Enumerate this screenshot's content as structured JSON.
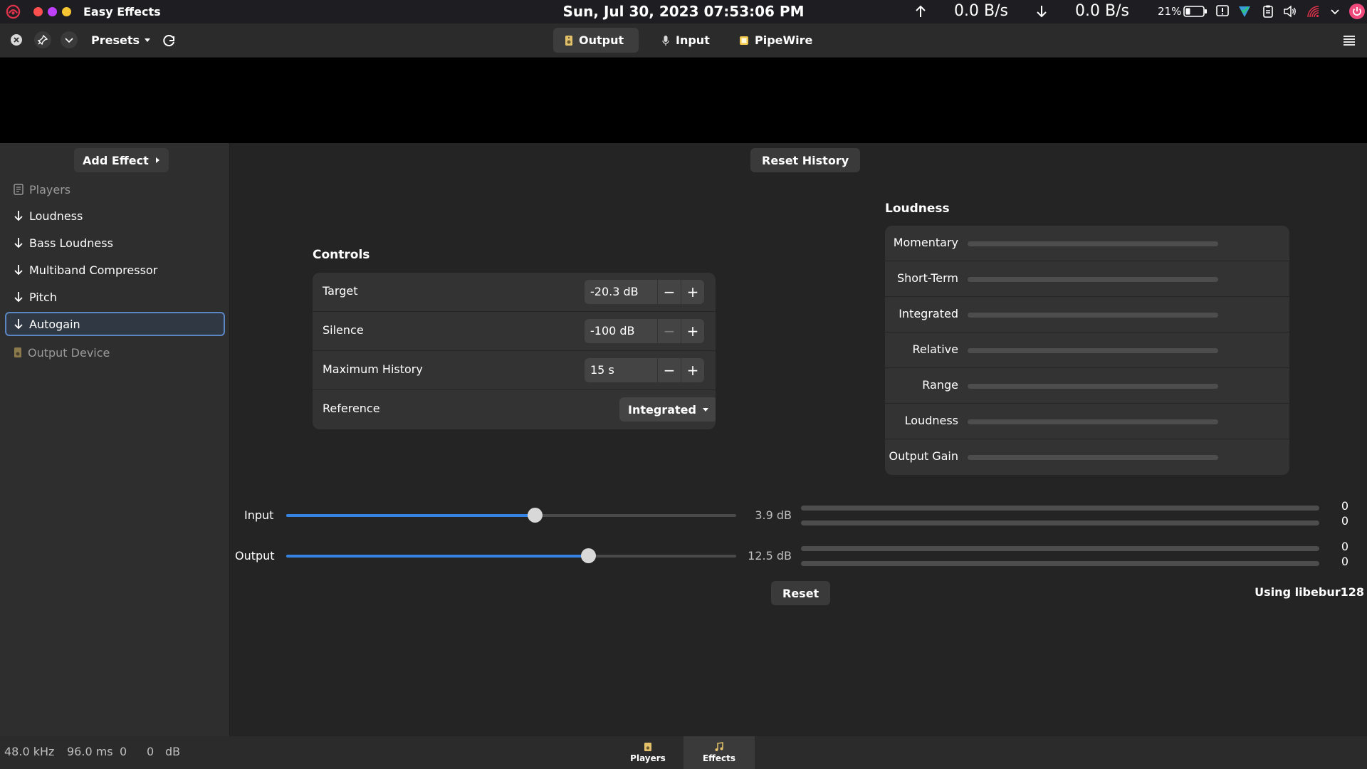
{
  "topbar": {
    "app_name": "Easy Effects",
    "datetime": "Sun, Jul 30, 2023  07:53:06 PM",
    "upload_rate": "0.0 B/s",
    "download_rate": "0.0 B/s",
    "battery_percent": "21%",
    "traffic_light_colors": [
      "#ff4f4f",
      "#c040ff",
      "#f7c531"
    ]
  },
  "header": {
    "presets_label": "Presets",
    "tabs": [
      {
        "label": "Output",
        "icon": "speaker-icon",
        "active": true
      },
      {
        "label": "Input",
        "icon": "microphone-icon",
        "active": false
      },
      {
        "label": "PipeWire",
        "icon": "pipewire-icon",
        "active": false
      }
    ]
  },
  "sidebar": {
    "add_effect_label": "Add Effect",
    "players_label": "Players",
    "effects": [
      "Loudness",
      "Bass Loudness",
      "Multiband Compressor",
      "Pitch",
      "Autogain"
    ],
    "selected": "Autogain",
    "output_device_label": "Output Device"
  },
  "main": {
    "reset_history_label": "Reset History",
    "controls": {
      "title": "Controls",
      "target": {
        "label": "Target",
        "value": "-20.3 dB"
      },
      "silence": {
        "label": "Silence",
        "value": "-100 dB"
      },
      "max_history": {
        "label": "Maximum History",
        "value": "15 s"
      },
      "reference": {
        "label": "Reference",
        "value": "Integrated"
      },
      "minus": "−",
      "plus": "+"
    },
    "loudness": {
      "title": "Loudness",
      "rows": [
        {
          "label": "Momentary",
          "level": 0
        },
        {
          "label": "Short-Term",
          "level": 0
        },
        {
          "label": "Integrated",
          "level": 0
        },
        {
          "label": "Relative",
          "level": 0
        },
        {
          "label": "Range",
          "level": 0
        },
        {
          "label": "Loudness",
          "level": 0
        },
        {
          "label": "Output Gain",
          "level": 0
        }
      ]
    },
    "gain": {
      "input": {
        "label": "Input",
        "value": "3.9 dB",
        "fraction": 0.552,
        "levels": [
          "0",
          "0"
        ]
      },
      "output": {
        "label": "Output",
        "value": "12.5 dB",
        "fraction": 0.671,
        "levels": [
          "0",
          "0"
        ]
      }
    },
    "reset_label": "Reset",
    "library_label": "Using libebur128"
  },
  "status": {
    "sample_rate": "48.0 kHz",
    "latency": "96.0 ms",
    "val1": "0",
    "val2": "0",
    "unit": "dB"
  },
  "bottom_tabs": [
    {
      "label": "Players",
      "icon": "players-icon",
      "active": false
    },
    {
      "label": "Effects",
      "icon": "music-note-icon",
      "active": true
    }
  ],
  "colors": {
    "accent": "#3584e4",
    "selection_border": "#5a86c4"
  }
}
